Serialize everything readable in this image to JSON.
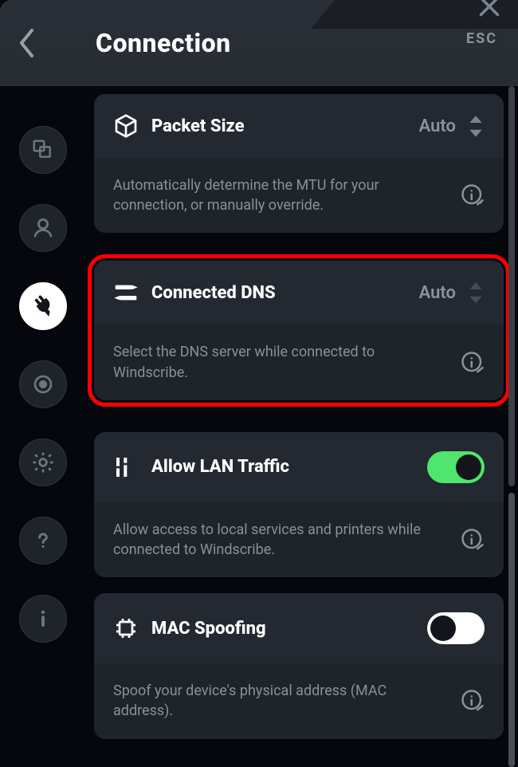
{
  "header": {
    "title": "Connection",
    "esc_label": "ESC"
  },
  "sidenav": {
    "items": [
      {
        "name": "general",
        "icon": "general"
      },
      {
        "name": "account",
        "icon": "account"
      },
      {
        "name": "connection",
        "icon": "connection",
        "active": true
      },
      {
        "name": "robert",
        "icon": "robert"
      },
      {
        "name": "advanced",
        "icon": "advanced"
      },
      {
        "name": "help",
        "icon": "help"
      },
      {
        "name": "about",
        "icon": "about"
      }
    ]
  },
  "cards": {
    "packet_size": {
      "title": "Packet Size",
      "value": "Auto",
      "desc": "Automatically determine the MTU for your connection, or manually override."
    },
    "connected_dns": {
      "title": "Connected DNS",
      "value": "Auto",
      "desc": "Select the DNS server while connected to Windscribe."
    },
    "allow_lan": {
      "title": "Allow LAN Traffic",
      "toggle": true,
      "desc": "Allow access to local services and printers while connected to Windscribe."
    },
    "mac_spoof": {
      "title": "MAC Spoofing",
      "toggle": false,
      "desc": "Spoof your device's physical address (MAC address)."
    }
  }
}
